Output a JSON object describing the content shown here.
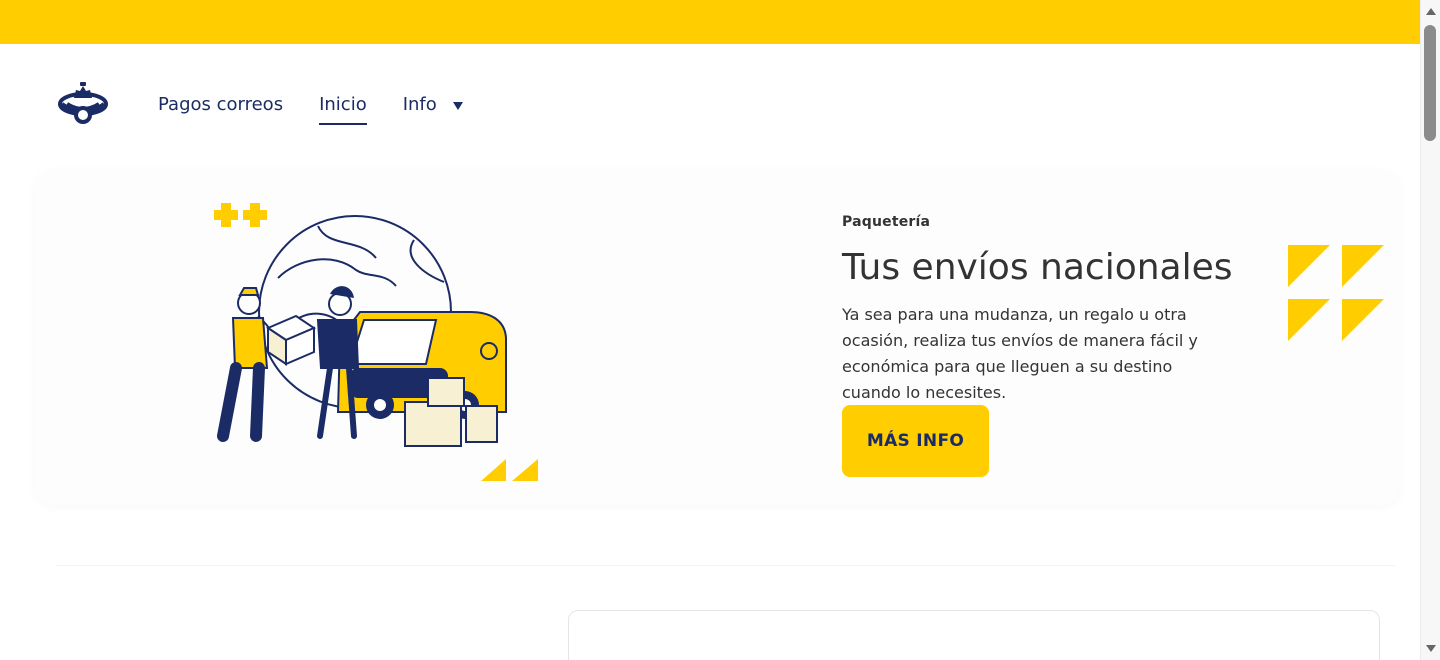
{
  "header": {
    "nav": [
      {
        "label": "Pagos correos"
      },
      {
        "label": "Inicio"
      },
      {
        "label": "Info"
      }
    ]
  },
  "hero": {
    "eyebrow": "Paquetería",
    "title": "Tus envíos nacionales",
    "description": "Ya sea para una mudanza, un regalo u otra ocasión, realiza tus envíos de manera fácil y económica para que lleguen a su destino cuando lo necesites.",
    "cta_label": "MÁS INFO"
  },
  "icons": {
    "logo": "correos-logo-icon",
    "info_caret": "chevron-down-icon",
    "decor": "yellow-triangle-pattern-icon"
  },
  "colors": {
    "brand_yellow": "#FFCD00",
    "brand_blue": "#1b2b66",
    "text_dark": "#333333"
  }
}
